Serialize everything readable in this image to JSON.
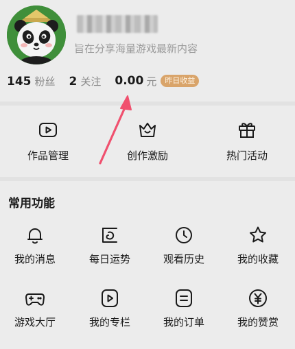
{
  "profile": {
    "bio": "旨在分享海量游戏最新内容"
  },
  "stats": {
    "fans_count": "145",
    "fans_label": "粉丝",
    "following_count": "2",
    "following_label": "关注",
    "income_value": "0.00",
    "income_unit": "元",
    "income_badge": "昨日收益"
  },
  "top_actions": [
    {
      "label": "作品管理",
      "icon": "play-icon"
    },
    {
      "label": "创作激励",
      "icon": "crown-icon"
    },
    {
      "label": "热门活动",
      "icon": "gift-icon"
    }
  ],
  "common_functions": {
    "title": "常用功能",
    "items": [
      {
        "label": "我的消息",
        "icon": "bell-icon"
      },
      {
        "label": "每日运势",
        "icon": "fortune-icon"
      },
      {
        "label": "观看历史",
        "icon": "clock-icon"
      },
      {
        "label": "我的收藏",
        "icon": "star-icon"
      },
      {
        "label": "游戏大厅",
        "icon": "gamepad-icon"
      },
      {
        "label": "我的专栏",
        "icon": "play-icon"
      },
      {
        "label": "我的订单",
        "icon": "order-icon"
      },
      {
        "label": "我的赞赏",
        "icon": "yen-icon"
      }
    ]
  },
  "colors": {
    "badge": "#d9a46a",
    "arrow": "#f0506e",
    "avatar_bg": "#3f8f3a"
  }
}
